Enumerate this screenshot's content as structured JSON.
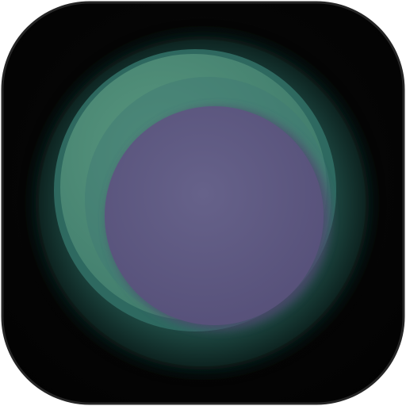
{
  "icon": {
    "name": "lens-app-icon",
    "colors": {
      "tile": "#050505",
      "tile_edge": "#1e1e1e",
      "outer_ring": "#0f2a26",
      "teal_ring": "#2f6b62",
      "green_disc": "#4d8a78",
      "purple_disc": "#5e5a7e",
      "purple_shadow": "#4f4870"
    }
  }
}
